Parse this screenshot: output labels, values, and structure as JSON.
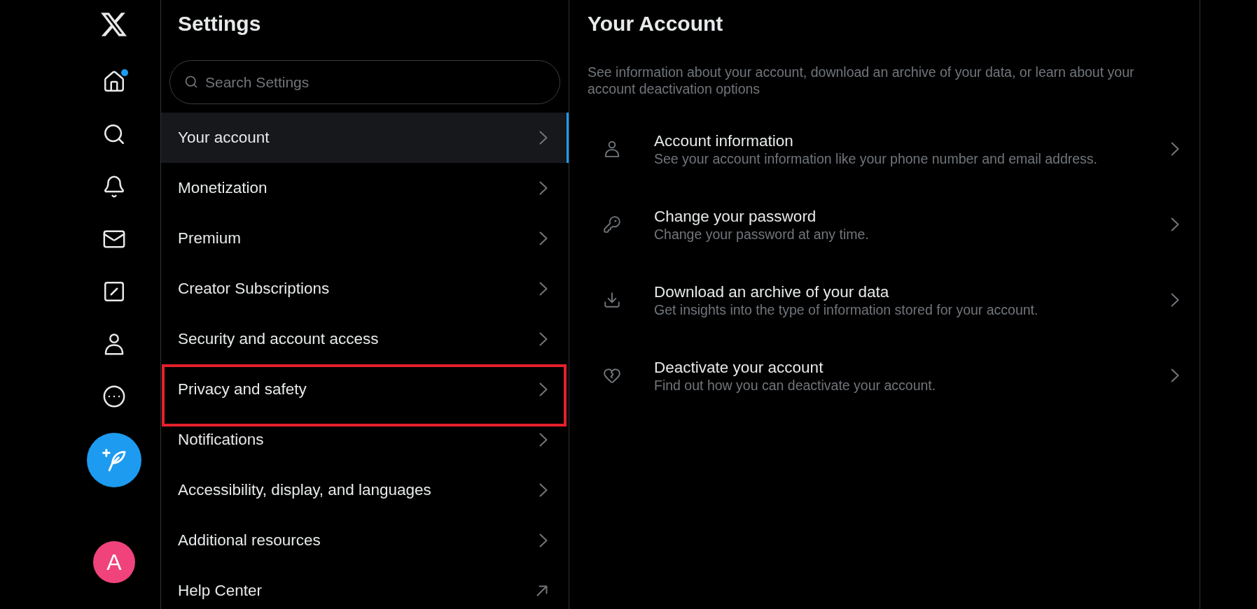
{
  "nav": {
    "items": [
      {
        "kind": "home",
        "badge": true
      },
      {
        "kind": "search",
        "badge": false
      },
      {
        "kind": "bell",
        "badge": false
      },
      {
        "kind": "mail",
        "badge": false
      },
      {
        "kind": "slash",
        "badge": false
      },
      {
        "kind": "person",
        "badge": false
      },
      {
        "kind": "more",
        "badge": false
      }
    ],
    "avatar": {
      "initial": "A"
    }
  },
  "settings": {
    "title": "Settings",
    "search": {
      "placeholder": "Search Settings"
    },
    "items": [
      {
        "label": "Your account",
        "kind": "chevron",
        "selected": true,
        "highlighted": false
      },
      {
        "label": "Monetization",
        "kind": "chevron",
        "selected": false,
        "highlighted": false
      },
      {
        "label": "Premium",
        "kind": "chevron",
        "selected": false,
        "highlighted": false
      },
      {
        "label": "Creator Subscriptions",
        "kind": "chevron",
        "selected": false,
        "highlighted": false
      },
      {
        "label": "Security and account access",
        "kind": "chevron",
        "selected": false,
        "highlighted": false
      },
      {
        "label": "Privacy and safety",
        "kind": "chevron",
        "selected": false,
        "highlighted": true
      },
      {
        "label": "Notifications",
        "kind": "chevron",
        "selected": false,
        "highlighted": false
      },
      {
        "label": "Accessibility, display, and languages",
        "kind": "chevron",
        "selected": false,
        "highlighted": false
      },
      {
        "label": "Additional resources",
        "kind": "chevron",
        "selected": false,
        "highlighted": false
      },
      {
        "label": "Help Center",
        "kind": "external",
        "selected": false,
        "highlighted": false
      }
    ]
  },
  "account": {
    "title": "Your Account",
    "description": "See information about your account, download an archive of your data, or learn about your account deactivation options",
    "items": [
      {
        "kind": "person",
        "title": "Account information",
        "subtitle": "See your account information like your phone number and email address."
      },
      {
        "kind": "key",
        "title": "Change your password",
        "subtitle": "Change your password at any time."
      },
      {
        "kind": "download",
        "title": "Download an archive of your data",
        "subtitle": "Get insights into the type of information stored for your account."
      },
      {
        "kind": "broken-heart",
        "title": "Deactivate your account",
        "subtitle": "Find out how you can deactivate your account."
      }
    ]
  }
}
